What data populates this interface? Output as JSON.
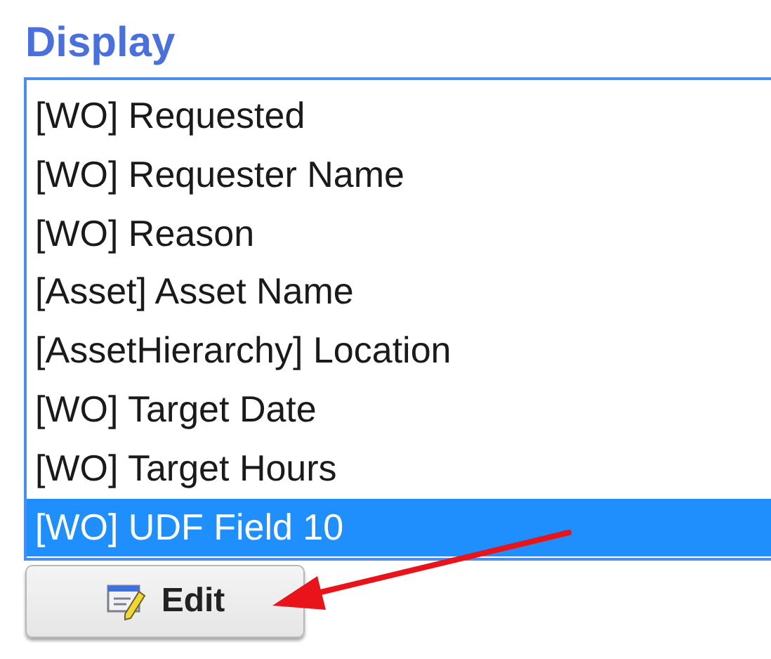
{
  "title": "Display",
  "list_items": [
    {
      "label": "[WO] Requested",
      "selected": false
    },
    {
      "label": "[WO] Requester Name",
      "selected": false
    },
    {
      "label": "[WO] Reason",
      "selected": false
    },
    {
      "label": "[Asset] Asset Name",
      "selected": false
    },
    {
      "label": "[AssetHierarchy] Location",
      "selected": false
    },
    {
      "label": "[WO] Target Date",
      "selected": false
    },
    {
      "label": "[WO] Target Hours",
      "selected": false
    },
    {
      "label": "[WO] UDF Field 10",
      "selected": true
    }
  ],
  "buttons": [
    {
      "label": "Edit"
    }
  ]
}
